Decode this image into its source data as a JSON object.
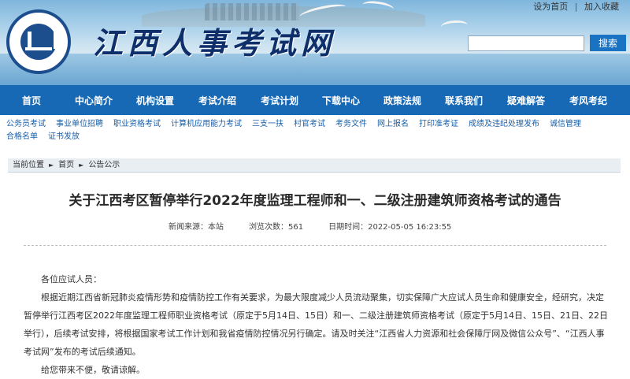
{
  "header": {
    "site_title": "江西人事考试网",
    "top_links": [
      "设为首页",
      "加入收藏"
    ],
    "search": {
      "placeholder": "",
      "button_label": "搜索"
    },
    "colors": {
      "nav_bg": "#1769b6",
      "title": "#0f2f6b"
    }
  },
  "nav": {
    "items": [
      "首页",
      "中心简介",
      "机构设置",
      "考试介绍",
      "考试计划",
      "下载中心",
      "政策法规",
      "联系我们",
      "疑难解答",
      "考风考纪"
    ]
  },
  "sub_links": [
    "公务员考试",
    "事业单位招聘",
    "职业资格考试",
    "计算机应用能力考试",
    "三支一扶",
    "村官考试",
    "考务文件",
    "网上报名",
    "打印准考证",
    "成绩及违纪处理发布",
    "诚信管理",
    "合格名单",
    "证书发放"
  ],
  "breadcrumb": {
    "label": "当前位置",
    "home": "首页",
    "current": "公告公示"
  },
  "article": {
    "title": "关于江西考区暂停举行2022年度监理工程师和一、二级注册建筑师资格考试的通告",
    "source": "新闻来源：本站",
    "views": "浏览次数：561",
    "date": "日期时间：2022-05-05 16:23:55",
    "paragraphs": [
      "各位应试人员：",
      "根据近期江西省新冠肺炎疫情形势和疫情防控工作有关要求，为最大限度减少人员流动聚集，切实保障广大应试人员生命和健康安全，经研究，决定暂停举行江西考区2022年度监理工程师职业资格考试（原定于5月14日、15日）和一、二级注册建筑师资格考试（原定于5月14日、15日、21日、22日举行），后续考试安排，将根据国家考试工作计划和我省疫情防控情况另行确定。请及时关注“江西省人力资源和社会保障厅网及微信公众号”、“江西人事考试网”发布的考试后续通知。",
      "给您带来不便，敬请谅解。"
    ]
  }
}
